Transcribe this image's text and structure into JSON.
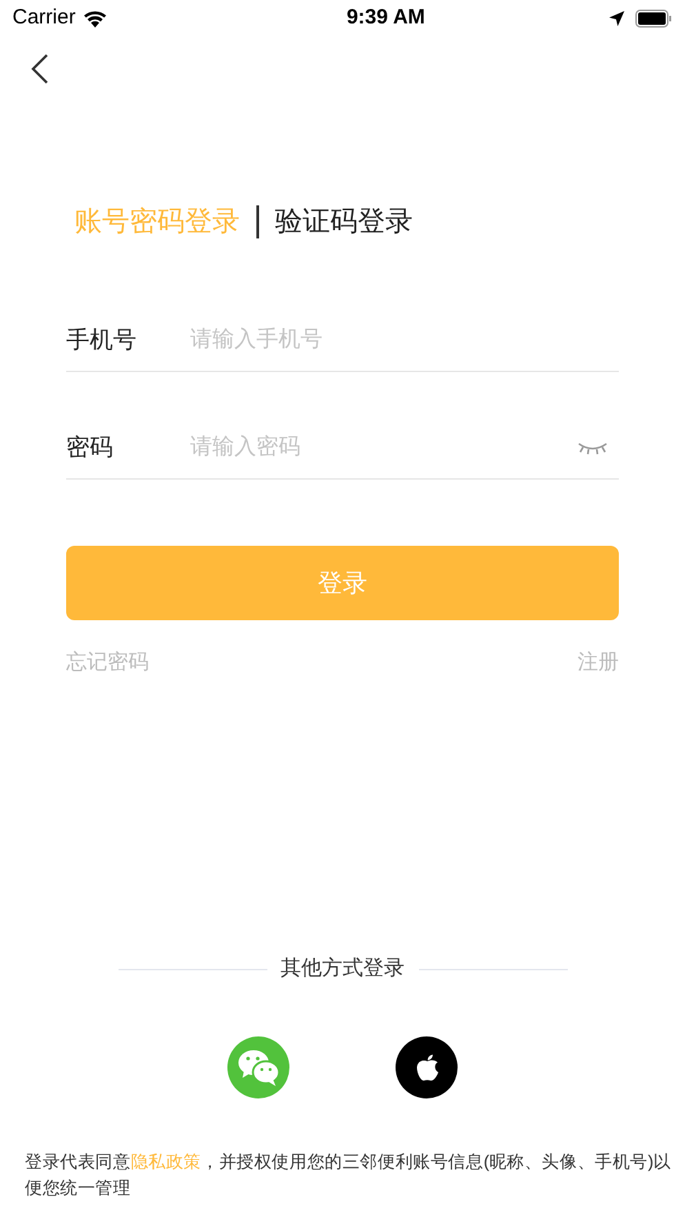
{
  "status_bar": {
    "carrier": "Carrier",
    "time": "9:39 AM"
  },
  "tabs": [
    {
      "label": "账号密码登录",
      "selected": true
    },
    {
      "label": "验证码登录",
      "selected": false
    }
  ],
  "fields": [
    {
      "label": "手机号",
      "placeholder": "请输入手机号",
      "kind": "text"
    },
    {
      "label": "密码",
      "placeholder": "请输入密码",
      "kind": "password"
    }
  ],
  "login_button": "登录",
  "links": {
    "forgot": "忘记密码",
    "register": "注册"
  },
  "other_login": {
    "title": "其他方式登录",
    "providers": [
      {
        "kind": "wechat"
      },
      {
        "kind": "apple"
      }
    ]
  },
  "consent": {
    "before": "登录代表同意",
    "link": "隐私政策",
    "after": "，并授权使用您的三邻便利账号信息(昵称、头像、手机号)以便您统一管理"
  }
}
